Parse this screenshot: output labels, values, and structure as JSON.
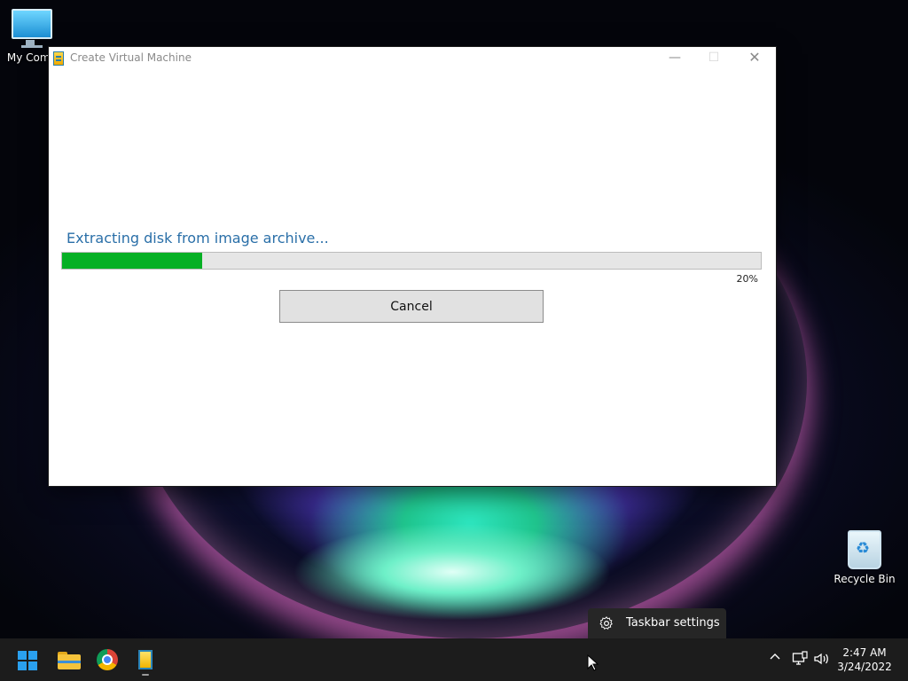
{
  "desktop": {
    "icons": [
      {
        "label": "My Comp"
      },
      {
        "label": "Recycle Bin"
      }
    ]
  },
  "window": {
    "title": "Create Virtual Machine",
    "controls": {
      "minimize": "—",
      "maximize": "☐",
      "close": "✕"
    },
    "status": "Extracting disk from image archive...",
    "progress_value": 20,
    "progress_label": "20%",
    "cancel_label": "Cancel"
  },
  "taskbar_popup": {
    "label": "Taskbar settings"
  },
  "taskbar": {
    "apps": [
      "start-icon",
      "file-explorer-icon",
      "chrome-icon",
      "archive-app-icon"
    ],
    "tray": {
      "chevron": "^",
      "time": "2:47 AM",
      "date": "3/24/2022"
    }
  },
  "colors": {
    "progress_fill": "#06b025",
    "status_text": "#2a6fa8",
    "taskbar": "#1c1c1c"
  }
}
